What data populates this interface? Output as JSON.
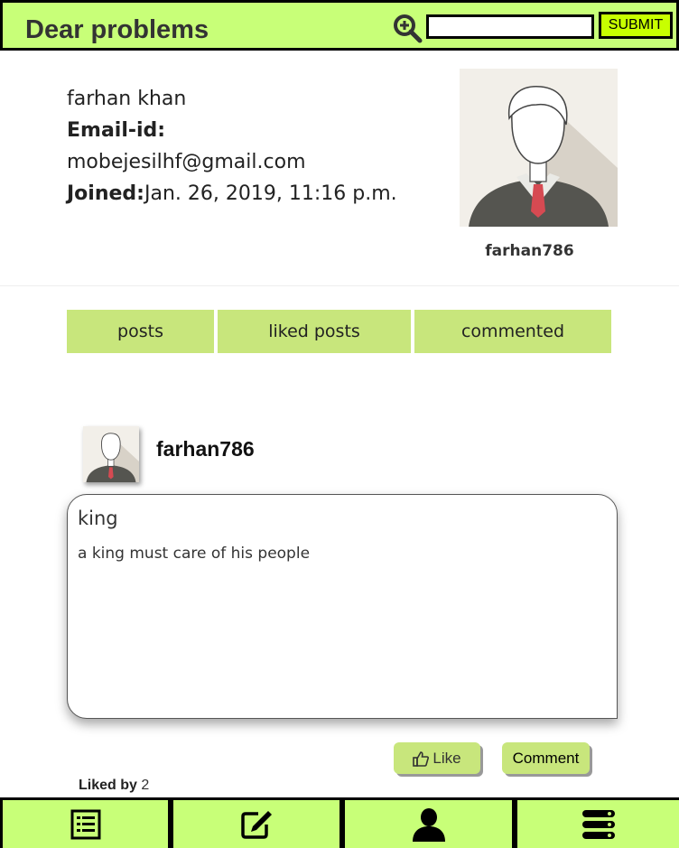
{
  "header": {
    "site_title": "Dear problems",
    "search_placeholder": "",
    "submit_label": "SUBMIT"
  },
  "profile": {
    "full_name": "farhan khan",
    "email_label": "Email-id:",
    "email": "mobejesilhf@gmail.com",
    "joined_label": "Joined:",
    "joined_date": "Jan. 26, 2019, 11:16 p.m.",
    "username": "farhan786"
  },
  "tabs": [
    {
      "label": "posts"
    },
    {
      "label": "liked posts"
    },
    {
      "label": "commented"
    }
  ],
  "post": {
    "author": "farhan786",
    "title": "king",
    "body": "a king must care of his people",
    "like_label": "Like",
    "comment_label": "Comment",
    "liked_by_label": "Liked by",
    "liked_by_count": "2"
  },
  "bottom_nav": [
    {
      "icon": "list-icon"
    },
    {
      "icon": "edit-icon"
    },
    {
      "icon": "user-icon"
    },
    {
      "icon": "menu-icon"
    }
  ],
  "colors": {
    "accent": "#c8ff78",
    "tab_bg": "#c8e67c",
    "submit_bg": "#c8ff00"
  }
}
